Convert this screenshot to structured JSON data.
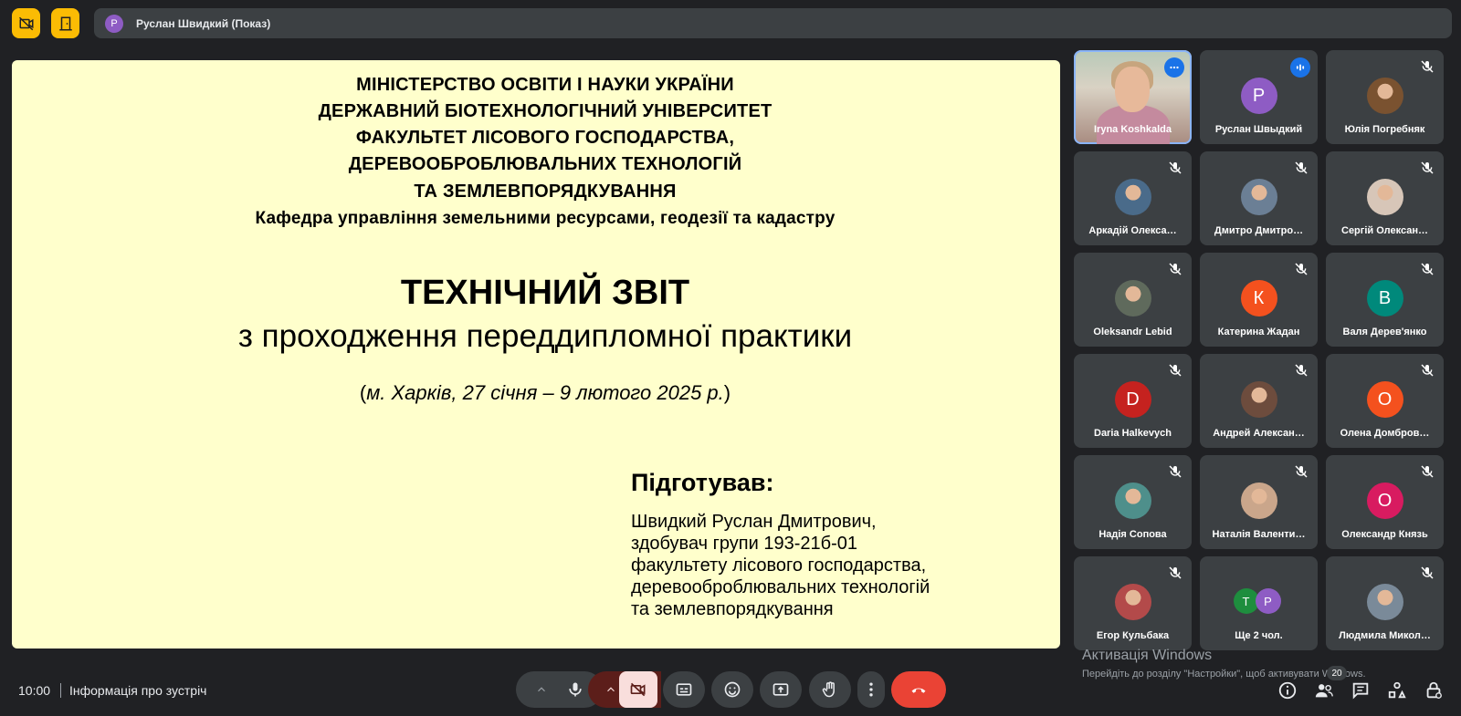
{
  "top_bar": {
    "presenter_avatar": "Р",
    "presenter_text": "Руслан Швидкий (Показ)"
  },
  "slide": {
    "header_lines": [
      "МІНІСТЕРСТВО ОСВІТИ І НАУКИ УКРАЇНИ",
      "ДЕРЖАВНИЙ БІОТЕХНОЛОГІЧНИЙ УНІВЕРСИТЕТ",
      "ФАКУЛЬТЕТ ЛІСОВОГО ГОСПОДАРСТВА,",
      "ДЕРЕВООБРОБЛЮВАЛЬНИХ ТЕХНОЛОГІЙ",
      "ТА ЗЕМЛЕВПОРЯДКУВАННЯ",
      "Кафедра управління земельними ресурсами, геодезії та кадастру"
    ],
    "title": "ТЕХНІЧНИЙ ЗВІТ",
    "subtitle": "з проходження переддипломної практики",
    "place_open": "(",
    "place_text": "м. Харків, 27 січня – 9 лютого 2025 р.",
    "place_close": ")",
    "prepared_label": "Підготував:",
    "prepared_lines": [
      "Швидкий Руслан Дмитрович,",
      "здобувач групи 193-21б-01",
      "факультету лісового господарства,",
      "деревооброблювальних технологій",
      "та землевпорядкування"
    ]
  },
  "participants": [
    {
      "name": "Iryna Koshkalda",
      "avatar": "",
      "color": "",
      "state": "options"
    },
    {
      "name": "Руслан Швыдкий",
      "avatar": "Р",
      "color": "#8e5cc4",
      "state": "speaking"
    },
    {
      "name": "Юлія Погребняк",
      "avatar": "",
      "color": "#7a5230",
      "state": "muted"
    },
    {
      "name": "Аркадій Олекса…",
      "avatar": "",
      "color": "#4a6b8a",
      "state": "muted"
    },
    {
      "name": "Дмитро Дмитро…",
      "avatar": "",
      "color": "#6b7f95",
      "state": "muted"
    },
    {
      "name": "Сергій Олексан…",
      "avatar": "",
      "color": "#d7c6b8",
      "state": "muted"
    },
    {
      "name": "Oleksandr Lebid",
      "avatar": "",
      "color": "#5f6a5c",
      "state": "muted"
    },
    {
      "name": "Катерина Жадан",
      "avatar": "К",
      "color": "#f4511e",
      "state": "muted"
    },
    {
      "name": "Валя Дерев'янко",
      "avatar": "В",
      "color": "#00897b",
      "state": "muted"
    },
    {
      "name": "Daria Halkevych",
      "avatar": "D",
      "color": "#c5221f",
      "state": "muted"
    },
    {
      "name": "Андрей Алексан…",
      "avatar": "",
      "color": "#6d4c3d",
      "state": "muted"
    },
    {
      "name": "Олена Домбров…",
      "avatar": "О",
      "color": "#f4511e",
      "state": "muted"
    },
    {
      "name": "Надія Сопова",
      "avatar": "",
      "color": "#4e8f8b",
      "state": "muted"
    },
    {
      "name": "Наталія Валенти…",
      "avatar": "",
      "color": "#caa68b",
      "state": "muted"
    },
    {
      "name": "Олександр Князь",
      "avatar": "О",
      "color": "#d81b60",
      "state": "muted"
    },
    {
      "name": "Егор Кульбака",
      "avatar": "",
      "color": "#b34a4a",
      "state": "muted"
    },
    {
      "name": "Ще 2 чол.",
      "avatar": "",
      "color": "",
      "state": "more",
      "chips": [
        {
          "letter": "Т",
          "color": "#1e8e3e"
        },
        {
          "letter": "Р",
          "color": "#8e5cc4"
        }
      ]
    },
    {
      "name": "Людмила Микол…",
      "avatar": "",
      "color": "#7a8a99",
      "state": "muted"
    }
  ],
  "watermark": {
    "title": "Активація Windows",
    "subtitle": "Перейдіть до розділу \"Настройки\", щоб активувати Windows."
  },
  "bottom_bar": {
    "time": "10:00",
    "meeting_info": "Інформація про зустріч",
    "people_count": "20"
  }
}
